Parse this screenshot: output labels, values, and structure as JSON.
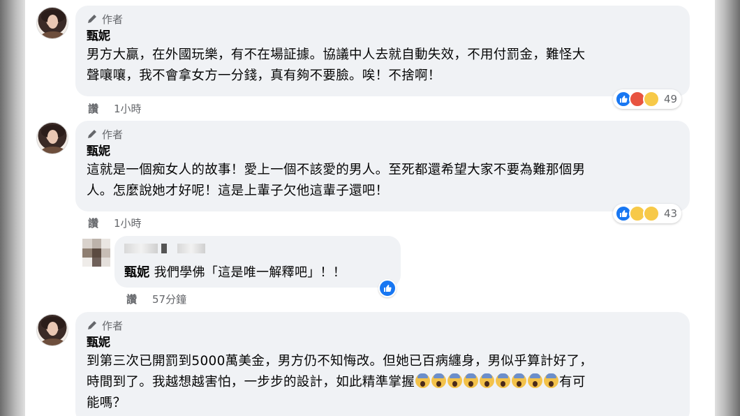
{
  "comments": [
    {
      "author_tag": "作者",
      "name": "甄妮",
      "lines": [
        "男方大贏，在外國玩樂，有不在場証據。協議中人去就自動失效，不用付罰金，難怪大",
        "聲嚷嚷，我不會拿女方一分錢，真有夠不要臉。唉！不捨啊！"
      ],
      "like_label": "讚",
      "time": "1小時",
      "reaction_count": "49"
    },
    {
      "author_tag": "作者",
      "name": "甄妮",
      "lines": [
        "這就是一個痴女人的故事！愛上一個不該愛的男人。至死都還希望大家不要為難那個男",
        "人。怎麼說她才好呢！這是上輩子欠他這輩子還吧！"
      ],
      "like_label": "讚",
      "time": "1小時",
      "reaction_count": "43"
    }
  ],
  "reply": {
    "mention": "甄妮",
    "text": "我們學佛「這是唯一解釋吧」！！",
    "like_label": "讚",
    "time": "57分鐘"
  },
  "third": {
    "author_tag": "作者",
    "name": "甄妮",
    "line1": "到第三次已開罰到5000萬美金，男方仍不知悔改。但她已百病纏身，男似乎算計好了，",
    "line2_before": "時間到了。我越想越害怕，一步步的設計，如此精準掌握",
    "line2_after": "有可",
    "line3": "能嗎？"
  },
  "icons": {
    "pen": "pencil-icon",
    "like": "thumbs-up-icon",
    "angry": "angry-reaction-icon",
    "sad": "sad-reaction-icon",
    "care": "care-reaction-icon",
    "scream": "face-screaming-in-fear-emoji"
  },
  "colors": {
    "like_blue": "#1877f2",
    "bubble": "#f0f2f5",
    "meta": "#65676b"
  }
}
